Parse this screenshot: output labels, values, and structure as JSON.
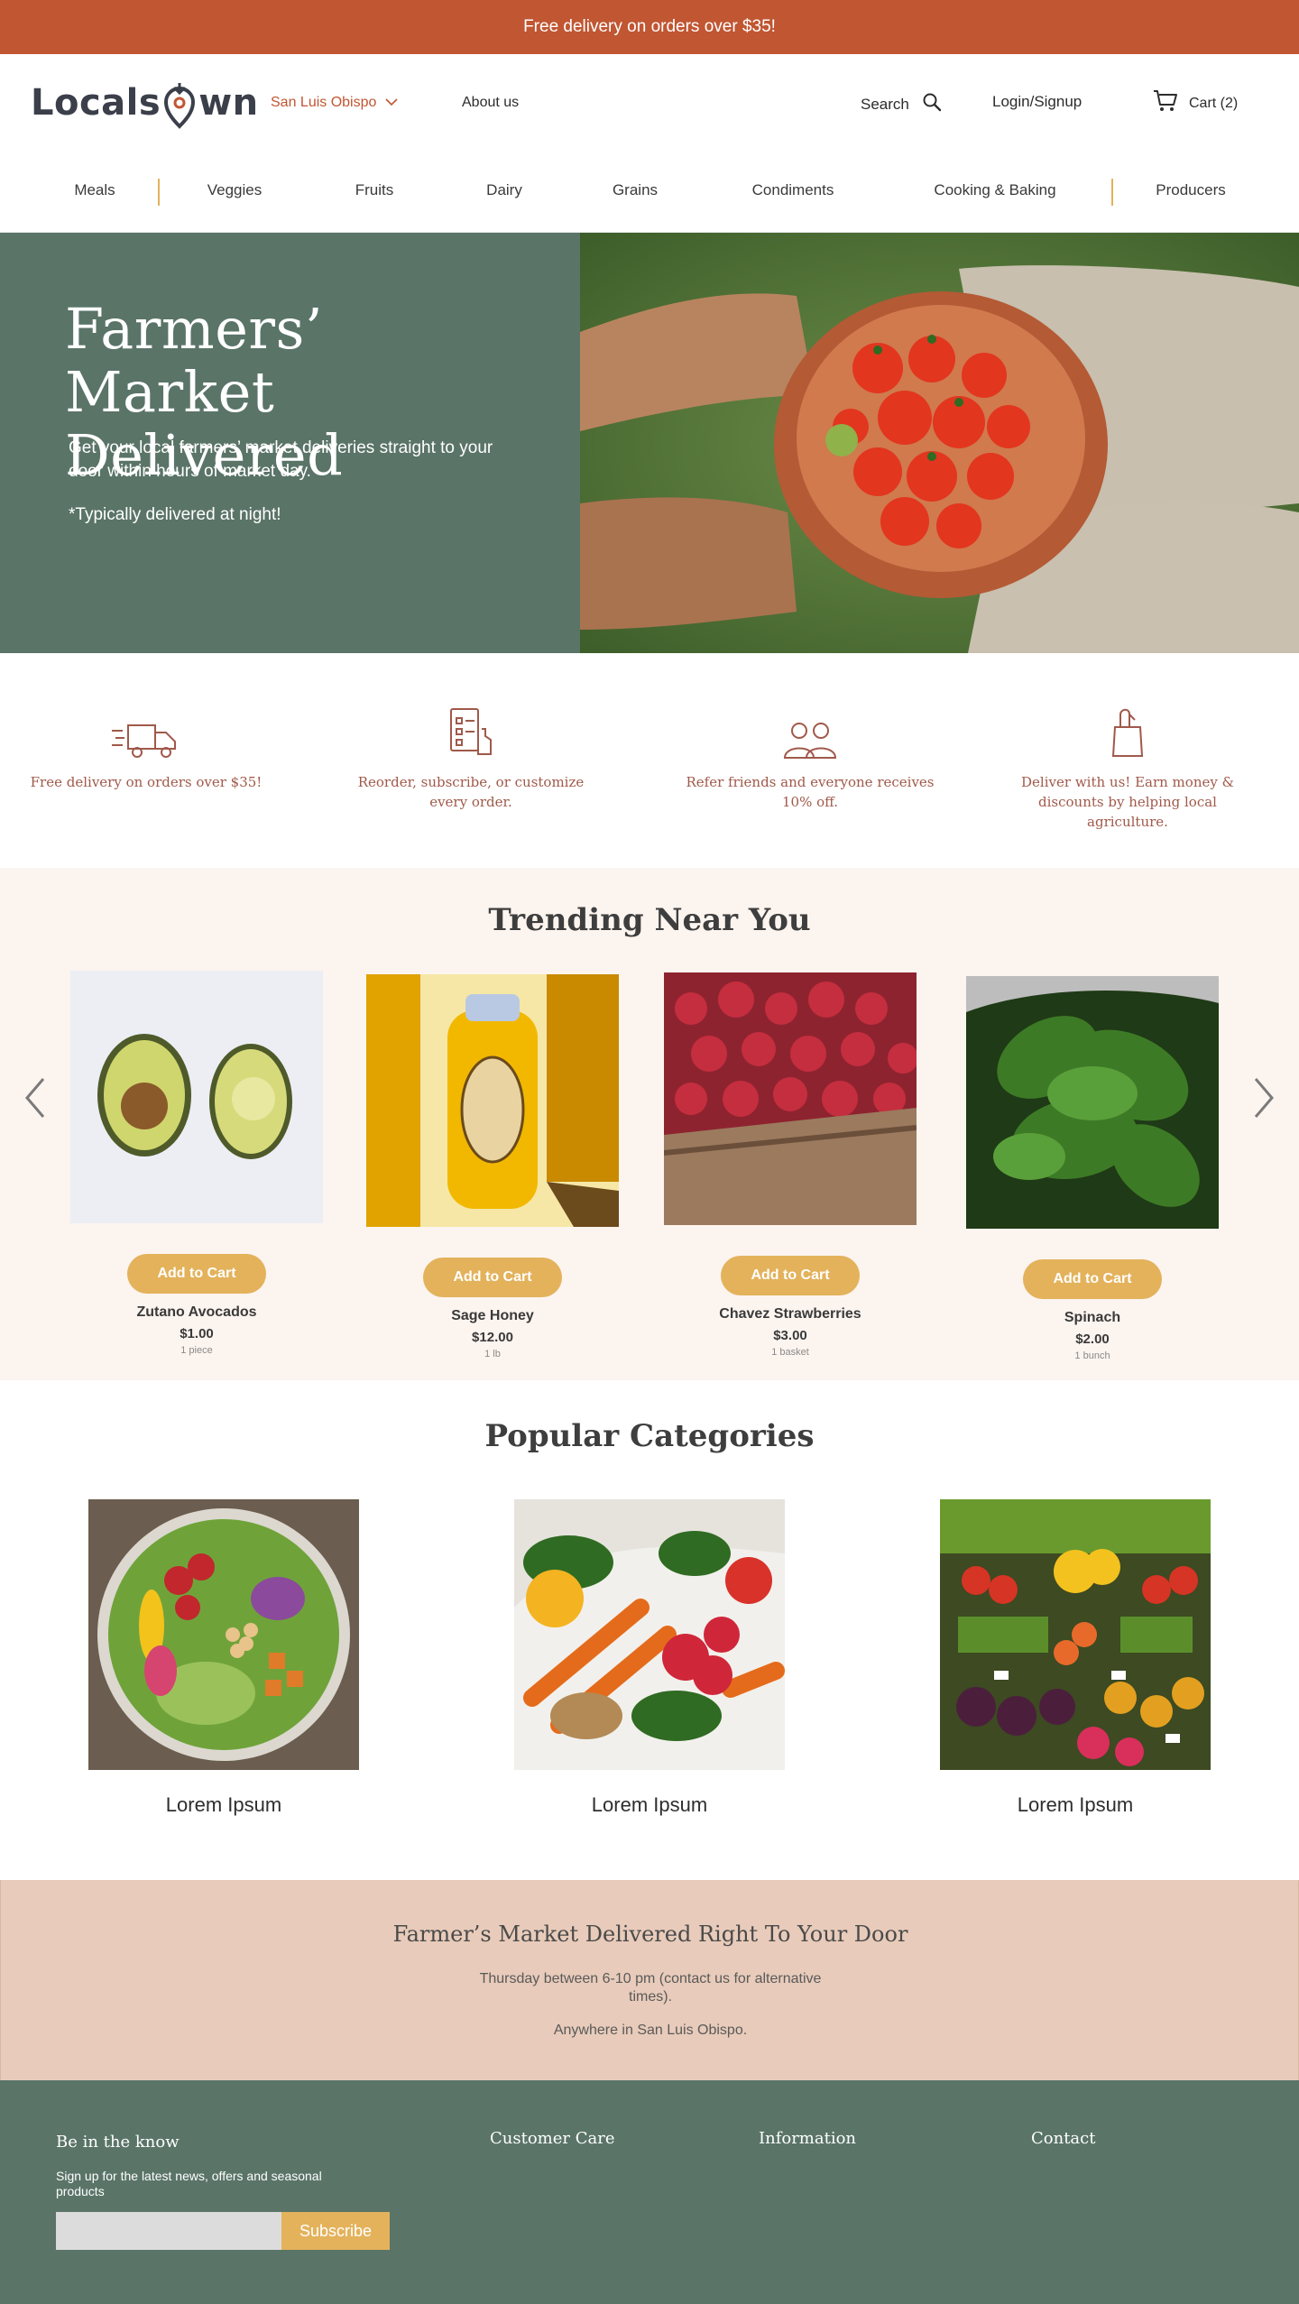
{
  "promo": {
    "text": "Free delivery on orders over $35!"
  },
  "header": {
    "logo_text_left": "Locals",
    "logo_text_right": "wn",
    "location": "San Luis Obispo",
    "about": "About us",
    "search": "Search",
    "login": "Login/Signup",
    "cart": "Cart (2)"
  },
  "categories_nav": [
    "Meals",
    "Veggies",
    "Fruits",
    "Dairy",
    "Grains",
    "Condiments",
    "Cooking & Baking",
    "Producers"
  ],
  "hero": {
    "title_line1": "Farmers’ Market",
    "title_line2": "Delivered",
    "description": "Get your local farmers’ market deliveries straight to your door within hours of market day.",
    "note": "*Typically delivered at night!"
  },
  "features": [
    {
      "icon": "truck-icon",
      "text": "Free delivery on orders over $35!"
    },
    {
      "icon": "checklist-icon",
      "text": "Reorder, subscribe, or customize every order."
    },
    {
      "icon": "people-icon",
      "text": "Refer friends and everyone receives 10% off."
    },
    {
      "icon": "shopping-bag-icon",
      "text": "Deliver with us! Earn money & discounts by helping local agriculture."
    }
  ],
  "trending": {
    "title": "Trending Near You",
    "add_label": "Add to Cart",
    "products": [
      {
        "name": "Zutano Avocados",
        "price": "$1.00",
        "unit": "1 piece"
      },
      {
        "name": "Sage Honey",
        "price": "$12.00",
        "unit": "1 lb"
      },
      {
        "name": "Chavez Strawberries",
        "price": "$3.00",
        "unit": "1 basket"
      },
      {
        "name": "Spinach",
        "price": "$2.00",
        "unit": "1 bunch"
      }
    ]
  },
  "popular": {
    "title": "Popular Categories",
    "items": [
      {
        "label": "Lorem Ipsum"
      },
      {
        "label": "Lorem Ipsum"
      },
      {
        "label": "Lorem Ipsum"
      }
    ]
  },
  "delivery": {
    "title": "Farmer’s Market Delivered Right To Your Door",
    "line1": "Thursday between 6-10 pm (contact us for alternative times).",
    "line2": "Anywhere in San Luis Obispo."
  },
  "footer": {
    "newsletter_title": "Be in the know",
    "newsletter_sub": "Sign up for the latest news, offers and seasonal products",
    "subscribe": "Subscribe",
    "col1": "Customer Care",
    "col2": "Information",
    "col3": "Contact"
  },
  "colors": {
    "brand_orange": "#c15632",
    "accent_gold": "#e3b25b",
    "sage_green": "#5a7468",
    "cream": "#fcf4ef",
    "blush": "#e8cbba",
    "feature_text": "#a0594a"
  }
}
